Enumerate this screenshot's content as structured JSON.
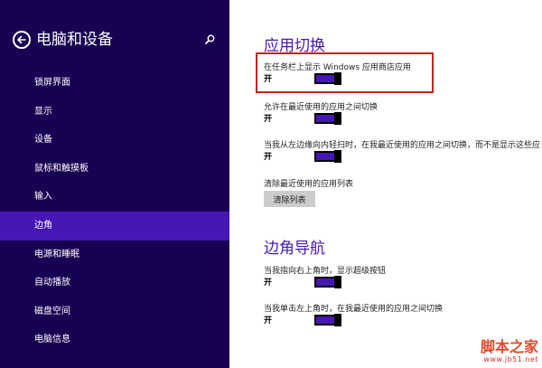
{
  "sidebar": {
    "title": "电脑和设备",
    "items": [
      {
        "label": "锁屏界面",
        "active": false
      },
      {
        "label": "显示",
        "active": false
      },
      {
        "label": "设备",
        "active": false
      },
      {
        "label": "鼠标和触摸板",
        "active": false
      },
      {
        "label": "输入",
        "active": false
      },
      {
        "label": "边角",
        "active": true
      },
      {
        "label": "电源和睡眠",
        "active": false
      },
      {
        "label": "自动播放",
        "active": false
      },
      {
        "label": "磁盘空间",
        "active": false
      },
      {
        "label": "电脑信息",
        "active": false
      }
    ]
  },
  "app_switching": {
    "title": "应用切换",
    "setting1": {
      "label": "在任务栏上显示 Windows 应用商店应用",
      "state": "开",
      "value": 1
    },
    "setting2": {
      "label": "允许在最近使用的应用之间切换",
      "state": "开",
      "value": 1
    },
    "setting3": {
      "label": "当我从左边缘向内轻扫时，在我最近使用的应用之间切换，而不是显示这些应",
      "state": "开",
      "value": 1
    },
    "clear_label": "清除最近使用的应用列表",
    "clear_button": "清除列表"
  },
  "corner_nav": {
    "title": "边角导航",
    "setting1": {
      "label": "当我指向右上角时，显示超级按钮",
      "state": "开",
      "value": 1
    },
    "setting2": {
      "label": "当我单击左上角时，在我最近使用的应用之间切换",
      "state": "开",
      "value": 1
    }
  },
  "watermark": {
    "title": "脚本之家",
    "url": "www.jb51.net"
  },
  "colors": {
    "sidebar_bg": "#180052",
    "accent": "#4617b4",
    "highlight_border": "#c4221b"
  }
}
